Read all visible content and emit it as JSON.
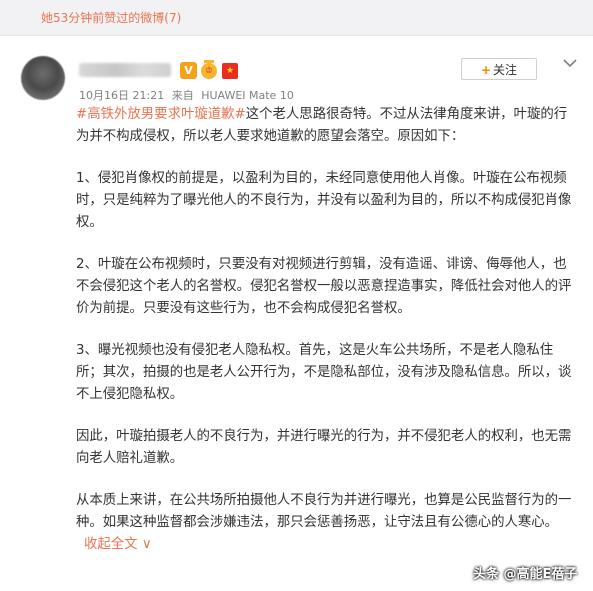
{
  "top_bar": {
    "text": "她53分钟前赞过的微博(7)"
  },
  "post": {
    "meta": {
      "time": "10月16日 21:21",
      "source_prefix": "来自",
      "device": "HUAWEI Mate 10"
    },
    "follow_button": {
      "label": "关注"
    },
    "hashtag": "#高铁外放男要求叶璇道歉#",
    "intro": "这个老人思路很奇特。不过从法律角度来讲，叶璇的行为并不构成侵权，所以老人要求她道歉的愿望会落空。原因如下：",
    "paragraphs": [
      "1、侵犯肖像权的前提是，以盈利为目的，未经同意使用他人肖像。叶璇在公布视频时，只是纯粹为了曝光他人的不良行为，并没有以盈利为目的，所以不构成侵犯肖像权。",
      "2、叶璇在公布视频时，只要没有对视频进行剪辑，没有造谣、诽谤、侮辱他人，也不会侵犯这个老人的名誉权。侵犯名誉权一般以恶意捏造事实，降低社会对他人的评价为前提。只要没有这些行为，也不会构成侵犯名誉权。",
      "3、曝光视频也没有侵犯老人隐私权。首先，这是火车公共场所，不是老人隐私住所；其次，拍摄的也是老人公开行为，不是隐私部位，没有涉及隐私信息。所以，谈不上侵犯隐私权。",
      "因此，叶璇拍摄老人的不良行为，并进行曝光的行为，并不侵犯老人的权利，也无需向老人赔礼道歉。"
    ],
    "last_paragraph": "从本质上来讲，在公共场所拍摄他人不良行为并进行曝光，也算是公民监督行为的一种。如果这种监督都会涉嫌违法，那只会惩善扬恶，让守法且有公德心的人寒心。",
    "collapse_link": "收起全文",
    "collapse_arrow": "∨"
  },
  "watermark": {
    "text": "头条 @高能E蓓子"
  },
  "icons": {
    "badge_v": "V",
    "badge_vip": "vip-crown-icon",
    "badge_flag": "china-flag-icon",
    "menu": "chevron-down-icon"
  },
  "colors": {
    "accent": "#eb7350",
    "follow_plus": "#ff8200",
    "top_bar_bg": "#f2f2f5"
  }
}
